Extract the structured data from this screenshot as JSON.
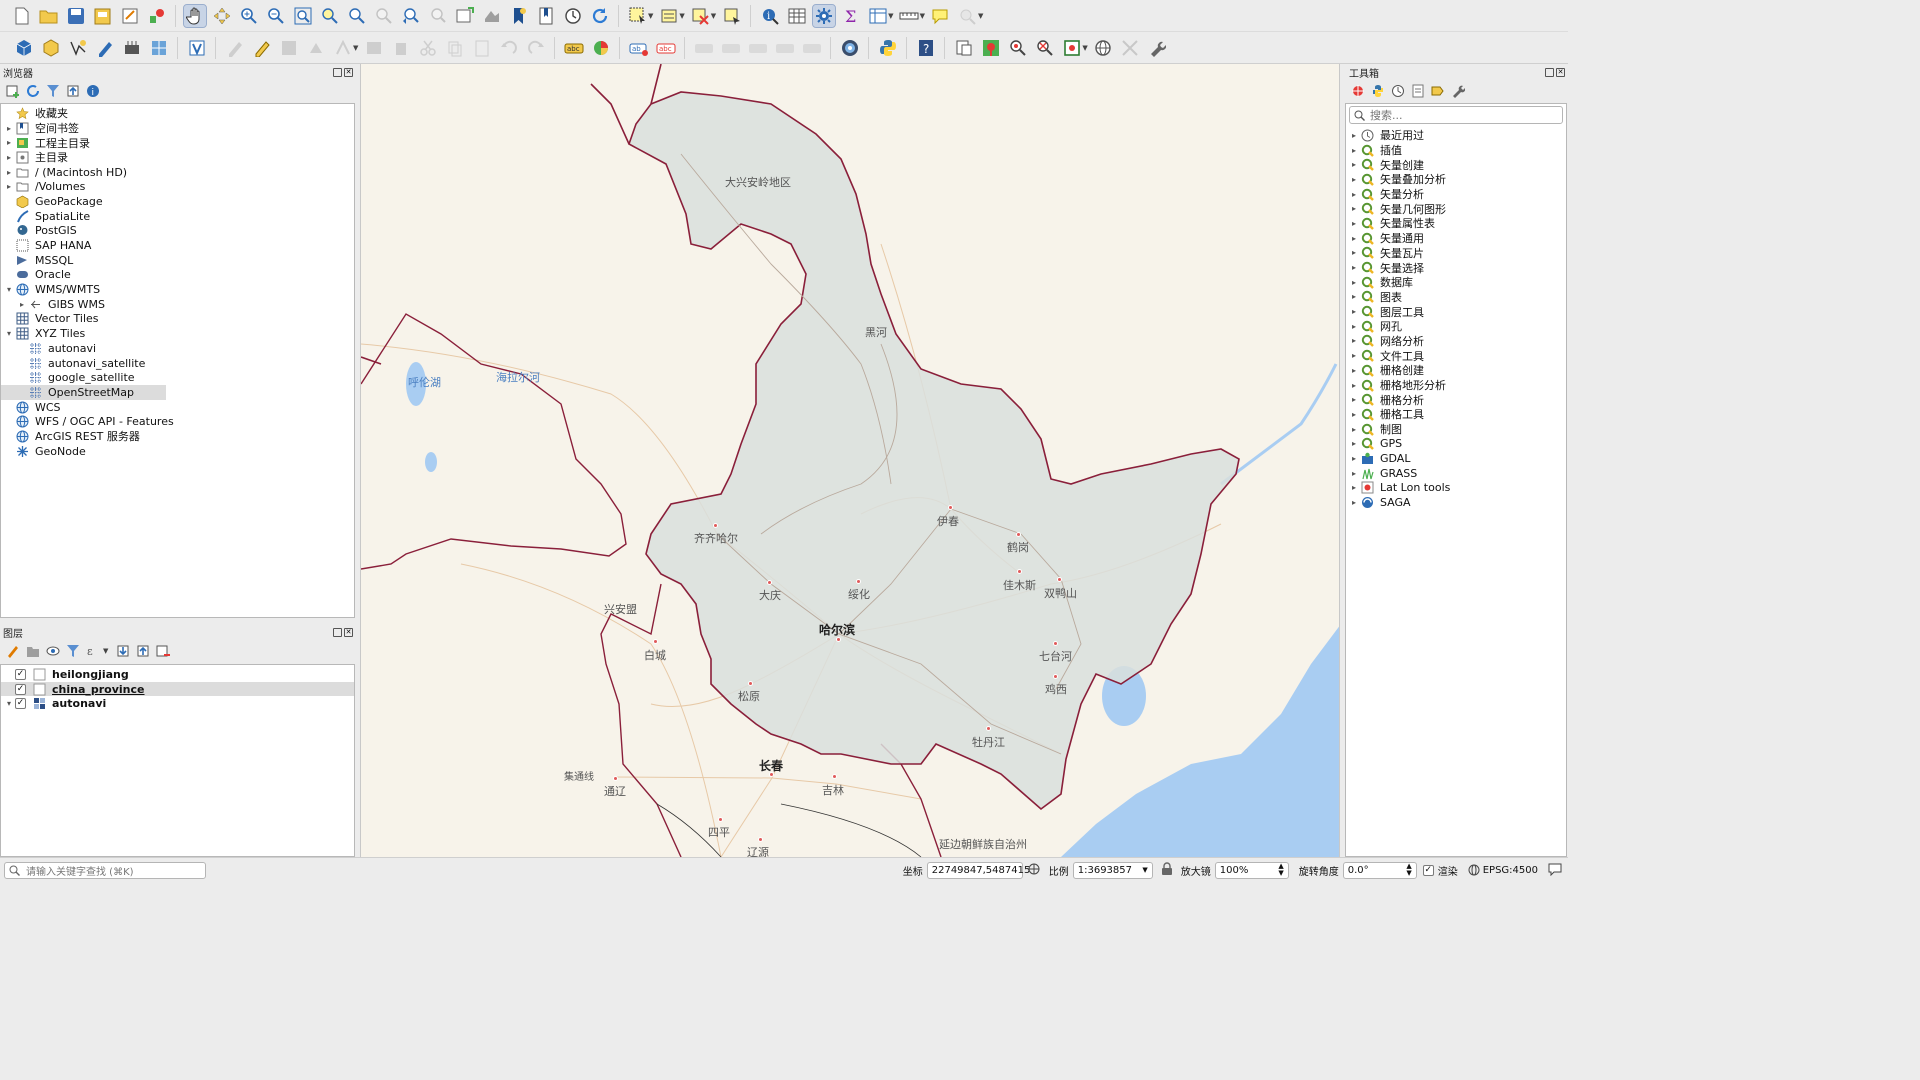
{
  "toolbar_top_icons": [
    "new-project",
    "open-project",
    "save-project",
    "save-as",
    "print-layout",
    "style-manager",
    "pan-map",
    "pan-to-selection",
    "zoom-in",
    "zoom-out",
    "zoom-full",
    "zoom-to-selection",
    "zoom-to-layer",
    "zoom-native",
    "zoom-last",
    "zoom-next",
    "new-map-view",
    "new-3d-map-view",
    "new-bookmark",
    "show-bookmarks",
    "temporal-controller",
    "refresh",
    "select-features",
    "deselect",
    "select-by-location",
    "identify",
    "attribute-table",
    "field-calculator",
    "statistical-summary",
    "open-attribute-table",
    "measure-line",
    "annotation",
    "plugins"
  ],
  "browser": {
    "title": "浏览器",
    "items": [
      {
        "label": "收藏夹",
        "icon": "star-icon",
        "arrow": ""
      },
      {
        "label": "空间书签",
        "icon": "bookmark-icon",
        "arrow": "▸"
      },
      {
        "label": "工程主目录",
        "icon": "project-folder-icon",
        "arrow": "▸"
      },
      {
        "label": "主目录",
        "icon": "home-icon",
        "arrow": "▸"
      },
      {
        "label": "/ (Macintosh HD)",
        "icon": "folder-icon",
        "arrow": "▸"
      },
      {
        "label": "/Volumes",
        "icon": "folder-icon",
        "arrow": "▸"
      },
      {
        "label": "GeoPackage",
        "icon": "geopackage-icon",
        "arrow": ""
      },
      {
        "label": "SpatiaLite",
        "icon": "spatialite-icon",
        "arrow": ""
      },
      {
        "label": "PostGIS",
        "icon": "postgis-icon",
        "arrow": ""
      },
      {
        "label": "SAP HANA",
        "icon": "hana-icon",
        "arrow": ""
      },
      {
        "label": "MSSQL",
        "icon": "mssql-icon",
        "arrow": ""
      },
      {
        "label": "Oracle",
        "icon": "oracle-icon",
        "arrow": ""
      },
      {
        "label": "WMS/WMTS",
        "icon": "globe-icon",
        "arrow": "▾"
      },
      {
        "label": "GIBS WMS",
        "icon": "wms-icon",
        "arrow": "▸",
        "indent": 1
      },
      {
        "label": "Vector Tiles",
        "icon": "grid-icon",
        "arrow": ""
      },
      {
        "label": "XYZ Tiles",
        "icon": "grid-icon",
        "arrow": "▾"
      },
      {
        "label": "autonavi",
        "icon": "tile-icon",
        "arrow": "",
        "indent": 1
      },
      {
        "label": "autonavi_satellite",
        "icon": "tile-icon",
        "arrow": "",
        "indent": 1
      },
      {
        "label": "google_satellite",
        "icon": "tile-icon",
        "arrow": "",
        "indent": 1
      },
      {
        "label": "OpenStreetMap",
        "icon": "tile-icon",
        "arrow": "",
        "indent": 1,
        "selected": true
      },
      {
        "label": "WCS",
        "icon": "globe-icon",
        "arrow": ""
      },
      {
        "label": "WFS / OGC API - Features",
        "icon": "globe-icon",
        "arrow": ""
      },
      {
        "label": "ArcGIS REST 服务器",
        "icon": "globe-icon",
        "arrow": ""
      },
      {
        "label": "GeoNode",
        "icon": "geonode-icon",
        "arrow": ""
      }
    ]
  },
  "layers": {
    "title": "图层",
    "items": [
      {
        "label": "heilongjiang",
        "checked": true,
        "arrow": ""
      },
      {
        "label": "china_province",
        "checked": true,
        "arrow": "",
        "selected": true
      },
      {
        "label": "autonavi",
        "checked": true,
        "arrow": "▾"
      }
    ]
  },
  "toolbox": {
    "title": "工具箱",
    "search_placeholder": "搜索...",
    "items": [
      {
        "label": "最近用过",
        "icon": "clock-icon"
      },
      {
        "label": "插值",
        "icon": "qgis-icon"
      },
      {
        "label": "矢量创建",
        "icon": "qgis-icon"
      },
      {
        "label": "矢量叠加分析",
        "icon": "qgis-icon"
      },
      {
        "label": "矢量分析",
        "icon": "qgis-icon"
      },
      {
        "label": "矢量几何图形",
        "icon": "qgis-icon"
      },
      {
        "label": "矢量属性表",
        "icon": "qgis-icon"
      },
      {
        "label": "矢量通用",
        "icon": "qgis-icon"
      },
      {
        "label": "矢量瓦片",
        "icon": "qgis-icon"
      },
      {
        "label": "矢量选择",
        "icon": "qgis-icon"
      },
      {
        "label": "数据库",
        "icon": "qgis-icon"
      },
      {
        "label": "图表",
        "icon": "qgis-icon"
      },
      {
        "label": "图层工具",
        "icon": "qgis-icon"
      },
      {
        "label": "网孔",
        "icon": "qgis-icon"
      },
      {
        "label": "网络分析",
        "icon": "qgis-icon"
      },
      {
        "label": "文件工具",
        "icon": "qgis-icon"
      },
      {
        "label": "栅格创建",
        "icon": "qgis-icon"
      },
      {
        "label": "栅格地形分析",
        "icon": "qgis-icon"
      },
      {
        "label": "栅格分析",
        "icon": "qgis-icon"
      },
      {
        "label": "栅格工具",
        "icon": "qgis-icon"
      },
      {
        "label": "制图",
        "icon": "qgis-icon"
      },
      {
        "label": "GPS",
        "icon": "qgis-icon"
      },
      {
        "label": "GDAL",
        "icon": "gdal-icon"
      },
      {
        "label": "GRASS",
        "icon": "grass-icon"
      },
      {
        "label": "Lat Lon tools",
        "icon": "latlon-icon"
      },
      {
        "label": "SAGA",
        "icon": "saga-icon"
      }
    ]
  },
  "map": {
    "labels": {
      "daxinganling": "大兴安岭地区",
      "heihe": "黑河",
      "hulun_lake": "呼伦湖",
      "hailar": "海拉尔河",
      "yichun": "伊春",
      "hegang": "鹤岗",
      "qiqihar": "齐齐哈尔",
      "jiamusi": "佳木斯",
      "shuangyashan": "双鸭山",
      "daqing": "大庆",
      "suihua": "绥化",
      "harbin": "哈尔滨",
      "xinganmeng": "兴安盟",
      "baicheng": "白城",
      "qitaihe": "七台河",
      "jixi": "鸡西",
      "songyuan": "松原",
      "mudanjiang": "牡丹江",
      "changchun": "长春",
      "jilin": "吉林",
      "tongliao": "通辽",
      "tongyu": "集通线",
      "siping": "四平",
      "liaoyuan": "辽源",
      "yanbian": "延边朝鲜族自治州"
    },
    "colors": {
      "province_fill": "#d9dfdd",
      "province_border": "#8a1f3a",
      "water": "#a9cdf2",
      "land": "#f7f3ea"
    }
  },
  "statusbar": {
    "search_placeholder": "请输入关键字查找 (⌘K)",
    "coord_label": "坐标",
    "coord_value": "22749847,5487415",
    "scale_label": "比例",
    "scale_value": "1:3693857",
    "magnifier_label": "放大镜",
    "magnifier_value": "100%",
    "rotation_label": "旋转角度",
    "rotation_value": "0.0°",
    "render_label": "渲染",
    "crs_label": "EPSG:4500"
  }
}
